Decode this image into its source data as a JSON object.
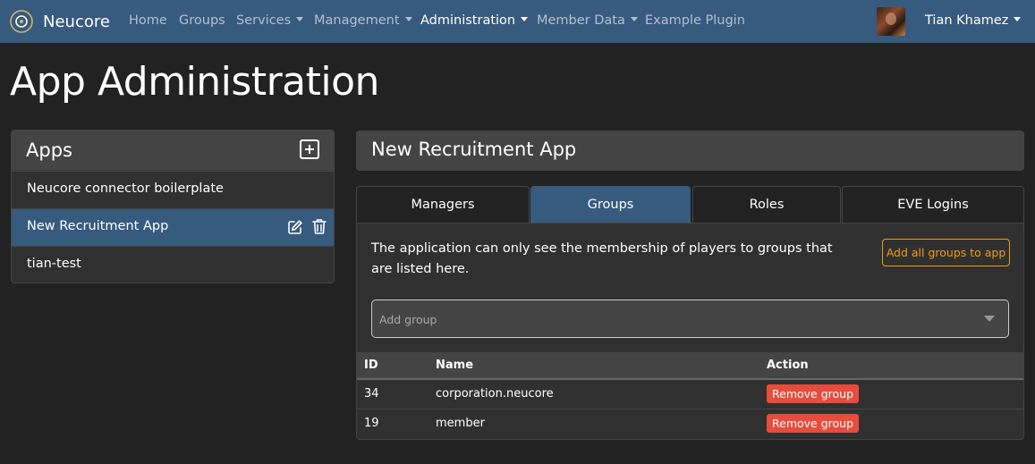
{
  "navbar": {
    "brand": "Neucore",
    "items": [
      {
        "label": "Home",
        "dropdown": false,
        "active": false
      },
      {
        "label": "Groups",
        "dropdown": false,
        "active": false
      },
      {
        "label": "Services",
        "dropdown": true,
        "active": false
      },
      {
        "label": "Management",
        "dropdown": true,
        "active": false
      },
      {
        "label": "Administration",
        "dropdown": true,
        "active": true
      },
      {
        "label": "Member Data",
        "dropdown": true,
        "active": false
      },
      {
        "label": "Example Plugin",
        "dropdown": false,
        "active": false
      }
    ],
    "user_name": "Tian Khamez"
  },
  "page_title": "App Administration",
  "apps_panel": {
    "title": "Apps",
    "items": [
      {
        "label": "Neucore connector boilerplate",
        "selected": false
      },
      {
        "label": "New Recruitment App",
        "selected": true
      },
      {
        "label": "tian-test",
        "selected": false
      }
    ]
  },
  "app_detail": {
    "title": "New Recruitment App",
    "tabs": [
      "Managers",
      "Groups",
      "Roles",
      "EVE Logins"
    ],
    "active_tab": "Groups",
    "info_text": "The application can only see the membership of players to groups that are listed here.",
    "add_all_button": "Add all groups to app",
    "add_group_placeholder": "Add group",
    "table": {
      "columns": [
        "ID",
        "Name",
        "Action"
      ],
      "rows": [
        {
          "id": "34",
          "name": "corporation.neucore",
          "action": "Remove group"
        },
        {
          "id": "19",
          "name": "member",
          "action": "Remove group"
        }
      ]
    }
  },
  "colors": {
    "primary": "#375a7f",
    "background": "#222222",
    "card": "#303030",
    "header": "#444444",
    "warning": "#f39c12",
    "danger": "#e74c3c"
  }
}
